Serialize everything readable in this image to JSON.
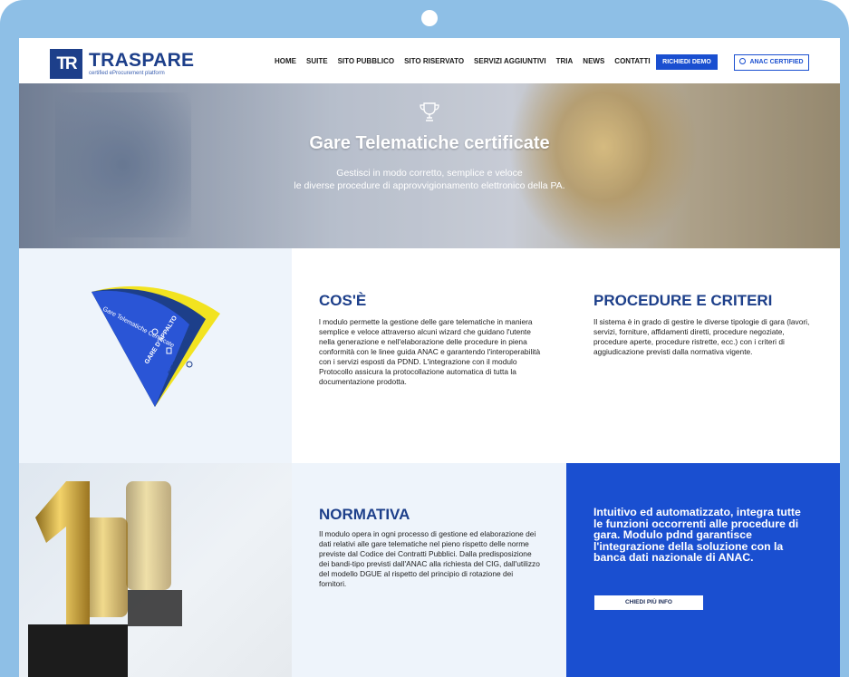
{
  "header": {
    "logo_mark": "TR",
    "logo_name": "TRASPARE",
    "logo_tagline": "certified eProcurement platform",
    "nav": [
      "HOME",
      "SUITE",
      "SITO PUBBLICO",
      "SITO RISERVATO",
      "SERVIZI AGGIUNTIVI",
      "TRIA",
      "NEWS",
      "CONTATTI"
    ],
    "demo_button": "RICHIEDI DEMO",
    "anac_button": "ANAC CERTIFIED"
  },
  "hero": {
    "title": "Gare Telematiche certificate",
    "subtitle_line1": "Gestisci in modo corretto, semplice e veloce",
    "subtitle_line2": "le diverse procedure di approvvigionamento elettronico della PA."
  },
  "fan": {
    "segment1": "Gare Telematiche Certificate",
    "segment2": "GARE D'APPALTO",
    "segment3": "SITO RISERVATO"
  },
  "cose": {
    "title": "COS'È",
    "text": "l modulo permette la gestione delle gare telematiche in maniera semplice e veloce attraverso alcuni wizard che guidano l'utente nella generazione e nell'elaborazione delle procedure in piena conformità con le linee guida ANAC e garantendo l'interoperabilità con i servizi esposti da PDND. L'integrazione con il modulo Protocollo assicura la protocollazione automatica di tutta la documentazione prodotta."
  },
  "procedure": {
    "title": "PROCEDURE E CRITERI",
    "text": "Il sistema è in grado di gestire le diverse tipologie di gara (lavori, servizi, forniture, affidamenti diretti, procedure negoziate, procedure aperte, procedure ristrette, ecc.) con i criteri di aggiudicazione previsti dalla normativa vigente."
  },
  "normativa": {
    "title": "NORMATIVA",
    "text": "Il modulo opera in ogni processo di gestione ed elaborazione dei dati relativi alle gare telematiche nel pieno rispetto delle norme previste dal Codice dei Contratti Pubblici. Dalla predisposizione dei bandi-tipo previsti dall'ANAC alla richiesta del CIG, dall'utilizzo del modello DGUE al rispetto del principio di rotazione dei fornitori."
  },
  "promo": {
    "text": "Intuitivo ed automatizzato, integra tutte le funzioni occorrenti alle procedure di gara. Modulo pdnd garantisce l'integrazione della soluzione con la banca dati nazionale di ANAC.",
    "button": "CHIEDI PIÙ INFO"
  },
  "colors": {
    "frame": "#8ebfe6",
    "brand_navy": "#1d3f8a",
    "accent_blue": "#1a4fd0",
    "fan_yellow": "#f2e320"
  }
}
